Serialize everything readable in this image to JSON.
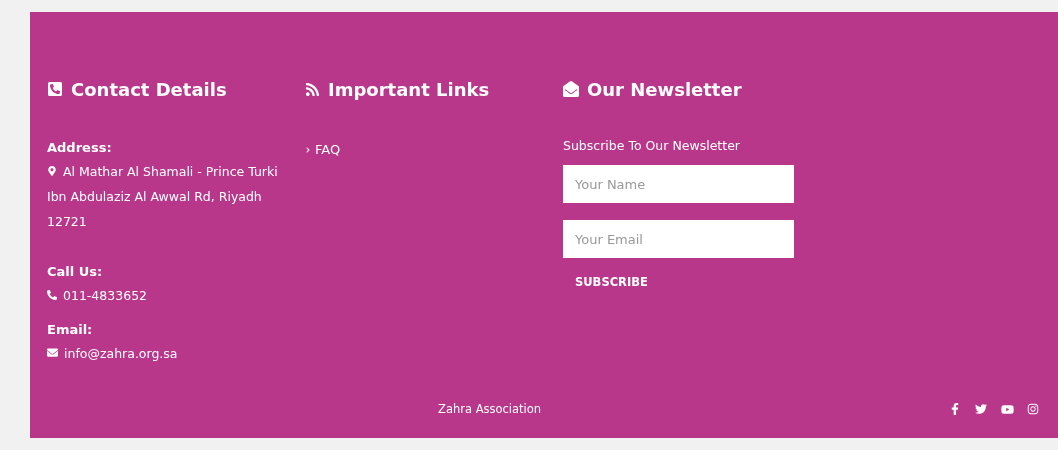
{
  "contact": {
    "title": "Contact Details",
    "items": [
      {
        "label": "Address:",
        "kind": "location",
        "value": "Al Mathar Al Shamali - Prince Turki Ibn Abdulaziz Al Awwal Rd, Riyadh 12721"
      },
      {
        "label": "Call Us:",
        "kind": "phone",
        "value": "011-4833652"
      },
      {
        "label": "Email:",
        "kind": "email",
        "value": "info@zahra.org.sa"
      }
    ]
  },
  "links": {
    "title": "Important Links",
    "items": [
      "FAQ"
    ]
  },
  "newsletter": {
    "title": "Our Newsletter",
    "intro": "Subscribe To Our Newsletter",
    "fields": [
      {
        "placeholder": "Your Name"
      },
      {
        "placeholder": "Your Email"
      }
    ],
    "button": "SUBSCRIBE"
  },
  "bottom": {
    "copyright": "Zahra Association",
    "social": [
      {
        "kind": "facebook"
      },
      {
        "kind": "twitter"
      },
      {
        "kind": "youtube"
      },
      {
        "kind": "instagram"
      }
    ]
  }
}
